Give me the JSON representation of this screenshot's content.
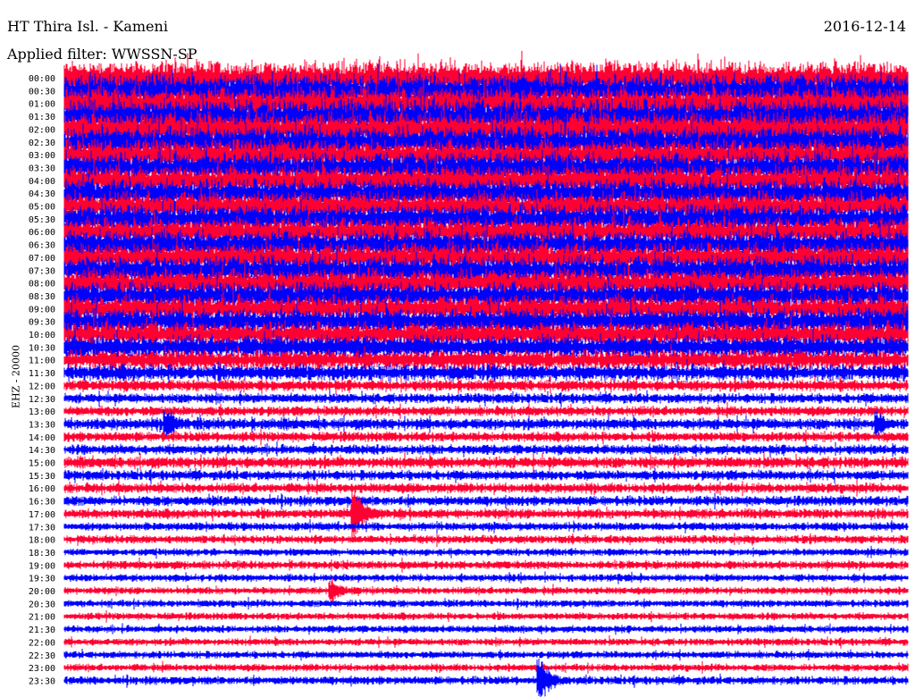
{
  "header": {
    "station": "HT Thira Isl. - Kameni",
    "date": "2016-12-14",
    "filter": "Applied filter: WWSSN-SP"
  },
  "chart_data": {
    "type": "line",
    "title": "HT Thira Isl. - Kameni",
    "ylabel": "EHZ - 20000",
    "minutes_per_line": 30,
    "colors": {
      "even": "#ff0033",
      "odd": "#0000ff"
    },
    "lines": [
      {
        "label": "00:00",
        "amp": 1.0
      },
      {
        "label": "00:30",
        "amp": 1.0
      },
      {
        "label": "01:00",
        "amp": 1.0
      },
      {
        "label": "01:30",
        "amp": 1.0
      },
      {
        "label": "02:00",
        "amp": 1.0
      },
      {
        "label": "02:30",
        "amp": 0.95
      },
      {
        "label": "03:00",
        "amp": 0.9
      },
      {
        "label": "03:30",
        "amp": 0.9
      },
      {
        "label": "04:00",
        "amp": 0.9
      },
      {
        "label": "04:30",
        "amp": 0.85
      },
      {
        "label": "05:00",
        "amp": 0.85
      },
      {
        "label": "05:30",
        "amp": 0.85
      },
      {
        "label": "06:00",
        "amp": 0.85
      },
      {
        "label": "06:30",
        "amp": 0.85
      },
      {
        "label": "07:00",
        "amp": 0.85
      },
      {
        "label": "07:30",
        "amp": 0.85
      },
      {
        "label": "08:00",
        "amp": 0.85
      },
      {
        "label": "08:30",
        "amp": 0.8
      },
      {
        "label": "09:00",
        "amp": 0.8
      },
      {
        "label": "09:30",
        "amp": 0.8
      },
      {
        "label": "10:00",
        "amp": 0.75
      },
      {
        "label": "10:30",
        "amp": 0.7
      },
      {
        "label": "11:00",
        "amp": 0.6
      },
      {
        "label": "11:30",
        "amp": 0.5
      },
      {
        "label": "12:00",
        "amp": 0.35
      },
      {
        "label": "12:30",
        "amp": 0.3
      },
      {
        "label": "13:00",
        "amp": 0.3
      },
      {
        "label": "13:30",
        "amp": 0.35,
        "events": [
          {
            "minute": 3.6,
            "amp": 2.2
          },
          {
            "minute": 28.9,
            "amp": 1.6
          }
        ]
      },
      {
        "label": "14:00",
        "amp": 0.3
      },
      {
        "label": "14:30",
        "amp": 0.3
      },
      {
        "label": "15:00",
        "amp": 0.35
      },
      {
        "label": "15:30",
        "amp": 0.3
      },
      {
        "label": "16:00",
        "amp": 0.3
      },
      {
        "label": "16:30",
        "amp": 0.3
      },
      {
        "label": "17:00",
        "amp": 0.3,
        "events": [
          {
            "minute": 10.3,
            "amp": 3.2
          }
        ]
      },
      {
        "label": "17:30",
        "amp": 0.25
      },
      {
        "label": "18:00",
        "amp": 0.25
      },
      {
        "label": "18:30",
        "amp": 0.22
      },
      {
        "label": "19:00",
        "amp": 0.25
      },
      {
        "label": "19:30",
        "amp": 0.22
      },
      {
        "label": "20:00",
        "amp": 0.22,
        "events": [
          {
            "minute": 9.5,
            "amp": 1.5
          }
        ]
      },
      {
        "label": "20:30",
        "amp": 0.22
      },
      {
        "label": "21:00",
        "amp": 0.22
      },
      {
        "label": "21:30",
        "amp": 0.22
      },
      {
        "label": "22:00",
        "amp": 0.22
      },
      {
        "label": "22:30",
        "amp": 0.22
      },
      {
        "label": "23:00",
        "amp": 0.22
      },
      {
        "label": "23:30",
        "amp": 0.25,
        "events": [
          {
            "minute": 16.9,
            "amp": 2.6
          }
        ]
      }
    ]
  }
}
